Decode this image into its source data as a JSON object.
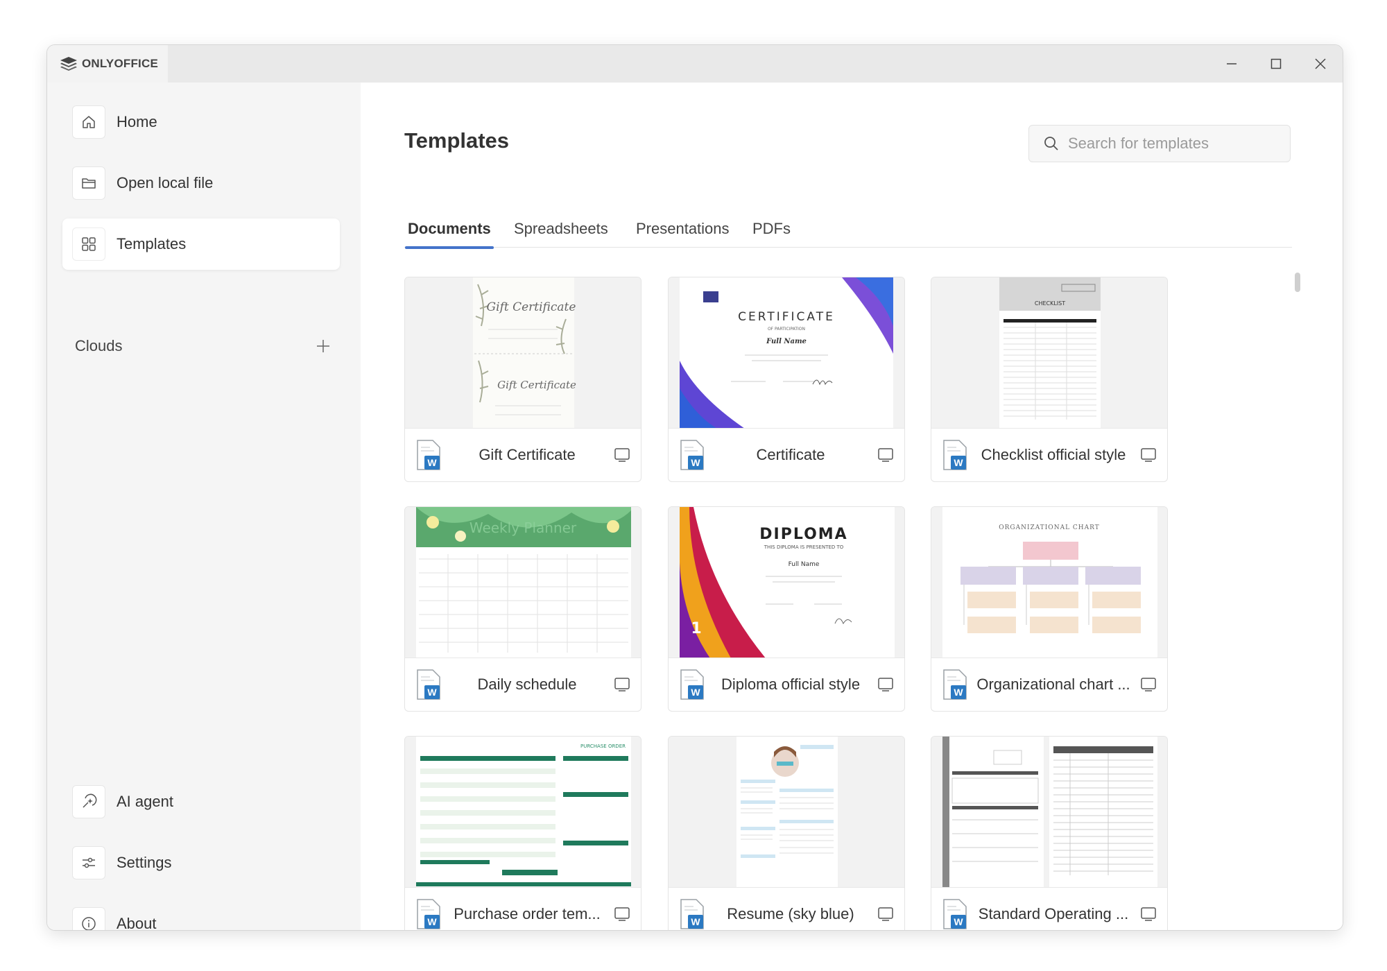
{
  "app": {
    "brand": "ONLYOFFICE"
  },
  "window_controls": {
    "minimize": "minimize-icon",
    "maximize": "maximize-icon",
    "close": "close-icon"
  },
  "sidebar": {
    "top_items": [
      {
        "label": "Home",
        "icon": "home-icon"
      },
      {
        "label": "Open local file",
        "icon": "folder-icon"
      },
      {
        "label": "Templates",
        "icon": "grid-icon",
        "active": true
      }
    ],
    "clouds": {
      "label": "Clouds",
      "add_icon": "plus-icon"
    },
    "bottom_items": [
      {
        "label": "AI agent",
        "icon": "ai-sparkle-icon"
      },
      {
        "label": "Settings",
        "icon": "sliders-icon"
      },
      {
        "label": "About",
        "icon": "info-icon"
      }
    ]
  },
  "main": {
    "title": "Templates",
    "search": {
      "placeholder": "Search for templates",
      "value": ""
    },
    "tabs": [
      {
        "label": "Documents",
        "active": true
      },
      {
        "label": "Spreadsheets"
      },
      {
        "label": "Presentations"
      },
      {
        "label": "PDFs"
      }
    ],
    "templates": [
      {
        "name": "Gift Certificate"
      },
      {
        "name": "Certificate"
      },
      {
        "name": "Checklist official style"
      },
      {
        "name": "Daily schedule"
      },
      {
        "name": "Diploma official style"
      },
      {
        "name": "Organizational chart ..."
      },
      {
        "name": "Purchase order tem..."
      },
      {
        "name": "Resume (sky blue)"
      },
      {
        "name": "Standard Operating ..."
      }
    ],
    "thumb_text": {
      "gift": "Gift Certificate",
      "cert_title": "CERTIFICATE",
      "cert_sub": "OF PARTICIPATION",
      "cert_name": "Full Name",
      "checklist": "CHECKLIST",
      "planner": "Weekly Planner",
      "diploma": "DIPLOMA",
      "diploma_sub": "THIS DIPLOMA IS PRESENTED TO",
      "diploma_name": "Full Name",
      "orgchart": "ORGANIZATIONAL CHART",
      "purchase": "PURCHASE ORDER"
    }
  },
  "colors": {
    "accent": "#4473ca",
    "word_blue": "#2b79c2",
    "sidebar_bg": "#f5f5f5",
    "titlebar_bg": "#e9e9e9"
  }
}
